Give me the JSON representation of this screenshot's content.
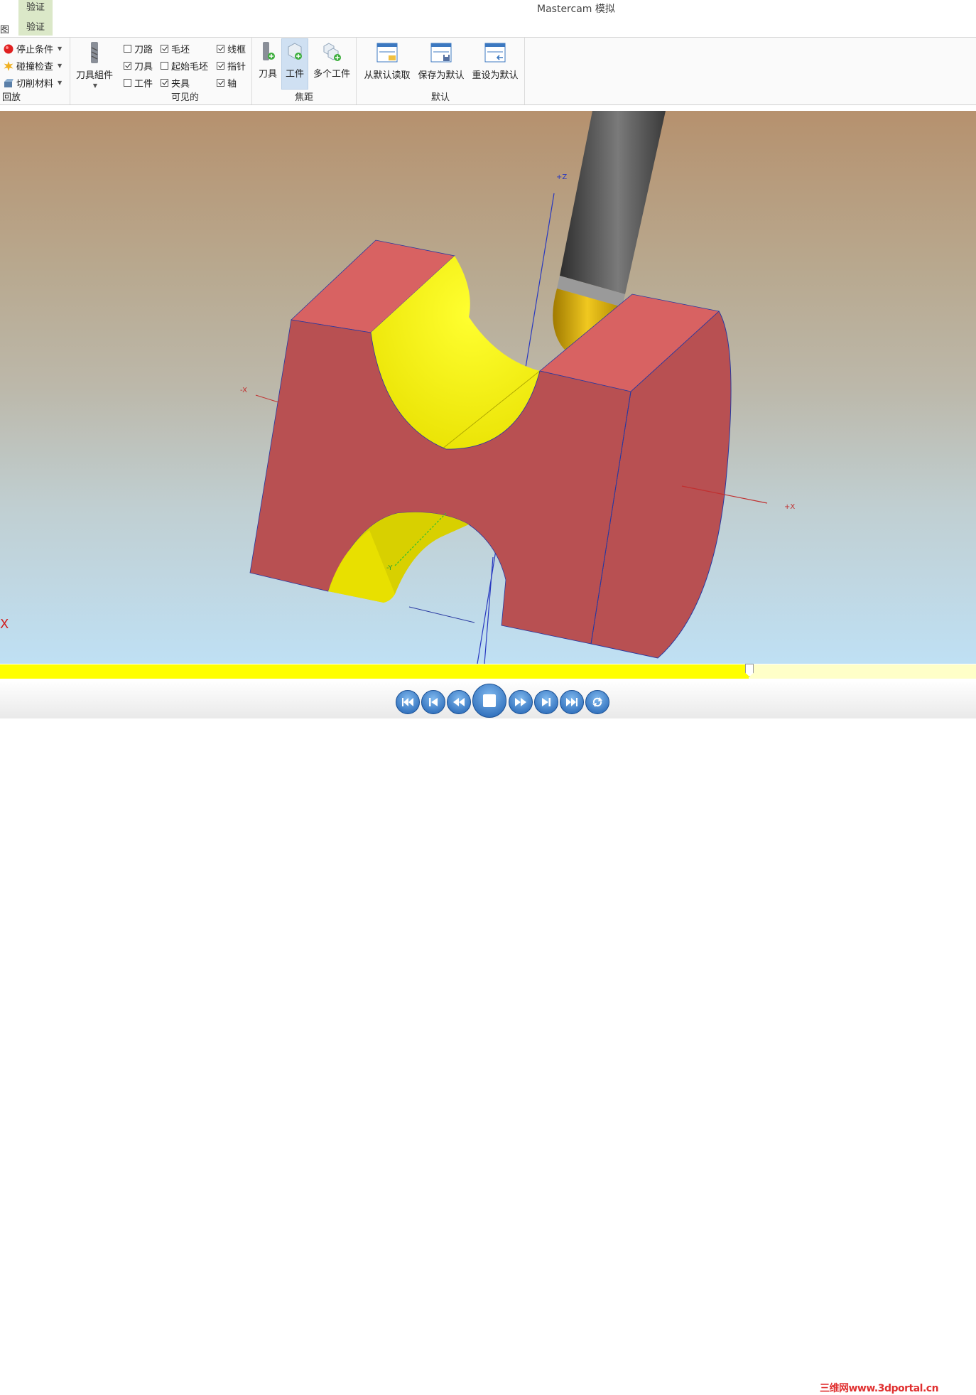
{
  "window": {
    "title": "Mastercam 模拟"
  },
  "tabs": {
    "group_label": "验证",
    "left_tab": "图",
    "active_tab": "验证"
  },
  "ribbon": {
    "playback": {
      "label": "回放",
      "items": [
        {
          "label": "停止条件",
          "icon": "stop-red-circle-icon"
        },
        {
          "label": "碰撞检查",
          "icon": "collision-burst-icon"
        },
        {
          "label": "切削材料",
          "icon": "cut-material-icon"
        }
      ]
    },
    "tool_assembly": {
      "label": "刀具組件"
    },
    "visible": {
      "label": "可见的",
      "checkboxes": [
        {
          "label": "刀路",
          "checked": false
        },
        {
          "label": "毛坯",
          "checked": true
        },
        {
          "label": "线框",
          "checked": true
        },
        {
          "label": "刀具",
          "checked": true
        },
        {
          "label": "起始毛坯",
          "checked": false
        },
        {
          "label": "指针",
          "checked": true
        },
        {
          "label": "工件",
          "checked": false
        },
        {
          "label": "夹具",
          "checked": true
        },
        {
          "label": "轴",
          "checked": true
        }
      ]
    },
    "focus": {
      "label": "焦距",
      "buttons": [
        {
          "label": "刀具",
          "active": false
        },
        {
          "label": "工件",
          "active": true
        },
        {
          "label": "多个工件",
          "active": false
        }
      ]
    },
    "defaults": {
      "label": "默认",
      "buttons": [
        {
          "label": "从默认读取"
        },
        {
          "label": "保存为默认"
        },
        {
          "label": "重设为默认"
        }
      ]
    }
  },
  "viewport": {
    "axis_labels": {
      "z_pos": "+Z",
      "x_neg": "-X",
      "x_pos": "+X",
      "y_neg": "-Y"
    },
    "colors": {
      "part": "#c0575a",
      "part_top": "#d86262",
      "machined": "#ffff00",
      "tool_shank": "#4a4a4a",
      "tool_tip": "#d8b010"
    }
  },
  "progress": {
    "value": 0.767
  },
  "playback_controls": {
    "buttons": [
      {
        "name": "skip-to-start",
        "icon": "skip-start-icon"
      },
      {
        "name": "step-back",
        "icon": "step-back-icon"
      },
      {
        "name": "rewind",
        "icon": "rewind-icon"
      },
      {
        "name": "stop",
        "icon": "stop-icon"
      },
      {
        "name": "fast-forward",
        "icon": "fast-forward-icon"
      },
      {
        "name": "step-forward",
        "icon": "step-forward-icon"
      },
      {
        "name": "skip-to-end",
        "icon": "skip-end-icon"
      },
      {
        "name": "loop",
        "icon": "loop-icon"
      }
    ]
  },
  "watermark": "三维网www.3dportal.cn"
}
